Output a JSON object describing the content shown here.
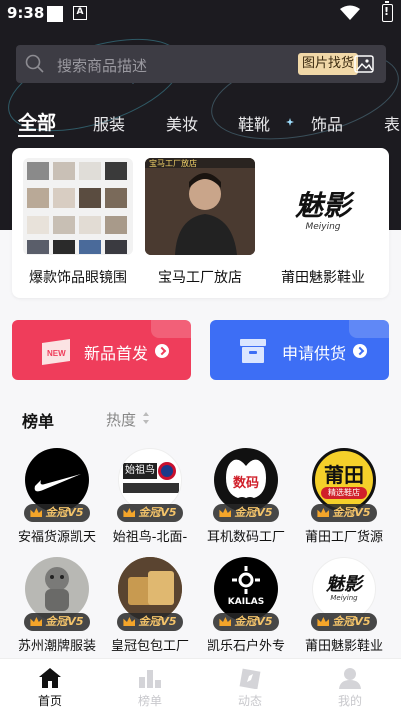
{
  "status_bar": {
    "time": "9:38",
    "a_label": "A"
  },
  "search": {
    "placeholder": "搜索商品描述",
    "image_search_label": "图片找货"
  },
  "categories": [
    "全部",
    "服装",
    "美妆",
    "鞋靴",
    "饰品",
    "表"
  ],
  "featured_shops": [
    {
      "name": "爆款饰品眼镜围"
    },
    {
      "name": "宝马工厂放店",
      "image_caption": "宝马工厂放店"
    },
    {
      "name": "莆田魅影鞋业",
      "logo_text": "魅影",
      "logo_sub": "Meiying"
    }
  ],
  "banners": {
    "new_products": "新品首发",
    "new_icon_text": "NEW",
    "apply_supply": "申请供货"
  },
  "ranking": {
    "title": "榜单",
    "sort_label": "热度"
  },
  "badge_text": "金冠V5",
  "ranked_shops": [
    {
      "name": "安福货源凯天"
    },
    {
      "name": "始祖鸟-北面-",
      "logo_text": "始祖鸟"
    },
    {
      "name": "耳机数码工厂",
      "logo_text": "数码"
    },
    {
      "name": "莆田工厂货源",
      "logo_text": "莆田",
      "logo_sub": "精选鞋店"
    },
    {
      "name": "苏州潮牌服装"
    },
    {
      "name": "皇冠包包工厂"
    },
    {
      "name": "凯乐石户外专",
      "logo_text": "KAILAS"
    },
    {
      "name": "莆田魅影鞋业",
      "logo_text": "魅影",
      "logo_sub": "Meiying"
    }
  ],
  "tabs": [
    "首页",
    "榜单",
    "动态",
    "我的"
  ],
  "colors": {
    "dark_header": "#1c1b20",
    "red_banner": "#ef3d5b",
    "blue_banner": "#3d6ef5",
    "badge_gold": "#f4c46a"
  }
}
